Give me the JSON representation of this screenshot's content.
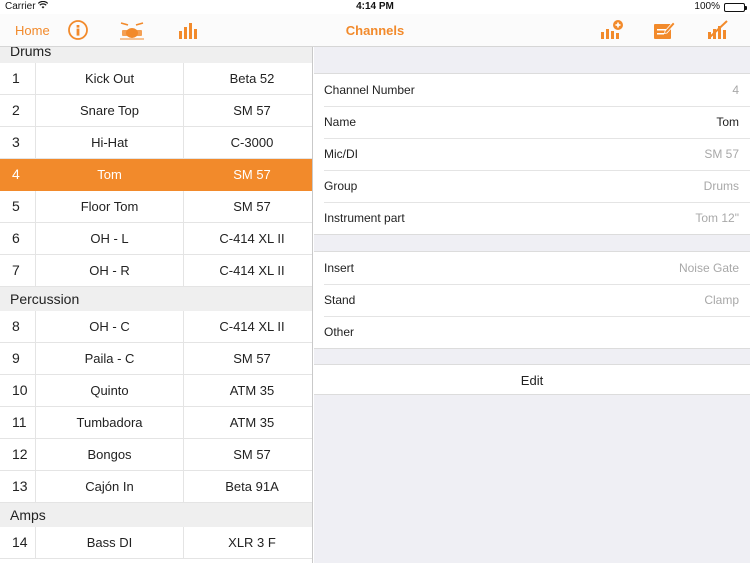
{
  "status_bar": {
    "carrier": "Carrier",
    "time": "4:14 PM",
    "battery": "100%"
  },
  "navbar": {
    "home_label": "Home",
    "title": "Channels",
    "accent_color": "#f28a2b",
    "left_icons": [
      "info-icon",
      "drum-kit-icon",
      "bar-chart-icon"
    ],
    "right_icons": [
      "add-chart-icon",
      "edit-note-icon",
      "chart-edit-icon"
    ]
  },
  "channels": {
    "sections": [
      {
        "title": "Drums",
        "rows": [
          {
            "num": "1",
            "name": "Kick Out",
            "mic": "Beta 52"
          },
          {
            "num": "2",
            "name": "Snare Top",
            "mic": "SM 57"
          },
          {
            "num": "3",
            "name": "Hi-Hat",
            "mic": "C-3000"
          },
          {
            "num": "4",
            "name": "Tom",
            "mic": "SM 57",
            "selected": true
          },
          {
            "num": "5",
            "name": "Floor Tom",
            "mic": "SM 57"
          },
          {
            "num": "6",
            "name": "OH - L",
            "mic": "C-414 XL II"
          },
          {
            "num": "7",
            "name": "OH - R",
            "mic": "C-414 XL II"
          }
        ]
      },
      {
        "title": "Percussion",
        "rows": [
          {
            "num": "8",
            "name": "OH - C",
            "mic": "C-414 XL II"
          },
          {
            "num": "9",
            "name": "Paila - C",
            "mic": "SM 57"
          },
          {
            "num": "10",
            "name": "Quinto",
            "mic": "ATM 35"
          },
          {
            "num": "11",
            "name": "Tumbadora",
            "mic": "ATM 35"
          },
          {
            "num": "12",
            "name": "Bongos",
            "mic": "SM 57"
          },
          {
            "num": "13",
            "name": "Cajón In",
            "mic": "Beta 91A"
          }
        ]
      },
      {
        "title": "Amps",
        "rows": [
          {
            "num": "14",
            "name": "Bass DI",
            "mic": "XLR 3 F"
          }
        ]
      }
    ]
  },
  "detail": {
    "group1": [
      {
        "label": "Channel Number",
        "value": "4"
      },
      {
        "label": "Name",
        "value": "Tom",
        "dark": true
      },
      {
        "label": "Mic/DI",
        "value": "SM 57"
      },
      {
        "label": "Group",
        "value": "Drums"
      },
      {
        "label": "Instrument part",
        "value": "Tom 12\""
      }
    ],
    "group2": [
      {
        "label": "Insert",
        "value": "Noise Gate"
      },
      {
        "label": "Stand",
        "value": "Clamp"
      },
      {
        "label": "Other",
        "value": ""
      }
    ],
    "edit_label": "Edit"
  }
}
